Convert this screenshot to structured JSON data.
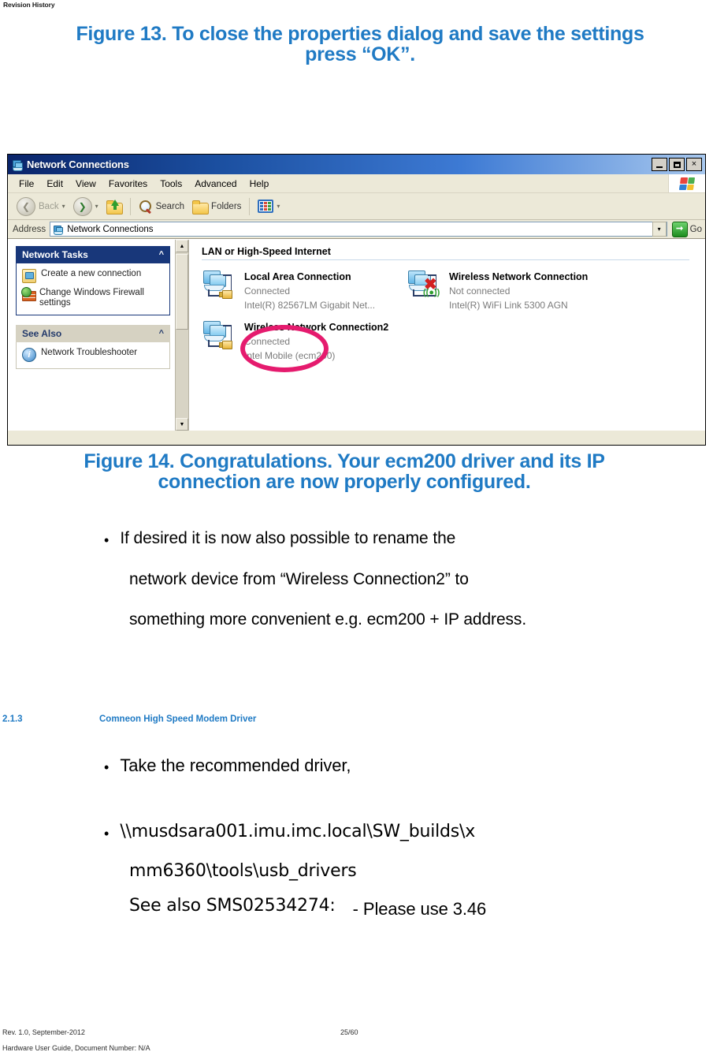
{
  "document": {
    "running_header": "Revision History",
    "figure13_caption_line1": "Figure 13. To close the properties dialog and save the settings",
    "figure13_caption_line2": "press “OK”.",
    "figure14_caption_line1": "Figure 14.  Congratulations. Your ecm200 driver and its IP",
    "figure14_caption_line2": "connection are now properly configured."
  },
  "explorer": {
    "title": "Network Connections",
    "title_icon": "network-connections-icon",
    "window_buttons": {
      "minimize": "minimize-icon",
      "maximize": "maximize-icon",
      "close": "×"
    },
    "menu": [
      "File",
      "Edit",
      "View",
      "Favorites",
      "Tools",
      "Advanced",
      "Help"
    ],
    "menu_logo": "windows-flag-icon",
    "toolbar": {
      "back_label": "Back",
      "back_icon": "back-arrow-icon",
      "forward_icon": "forward-arrow-icon",
      "up_icon": "folder-up-icon",
      "search_label": "Search",
      "search_icon": "search-icon",
      "folders_label": "Folders",
      "folders_icon": "folder-icon",
      "views_icon": "views-icon",
      "dropdown_caret": "▾"
    },
    "address": {
      "label": "Address",
      "value": "Network Connections",
      "icon": "network-connections-icon",
      "dropdown_caret": "▾",
      "go_label": "Go",
      "go_icon": "go-arrow-icon"
    },
    "sidebar": {
      "panels": [
        {
          "title": "Network Tasks",
          "collapse_icon": "chevron-up-icon",
          "style": "blue",
          "items": [
            {
              "label": "Create a new connection",
              "icon": "new-connection-icon"
            },
            {
              "label": "Change Windows Firewall settings",
              "icon": "firewall-icon"
            }
          ]
        },
        {
          "title": "See Also",
          "collapse_icon": "chevron-up-icon",
          "style": "gray",
          "items": [
            {
              "label": "Network Troubleshooter",
              "icon": "info-icon"
            }
          ]
        }
      ]
    },
    "scrollbar": {
      "up_arrow": "▲",
      "down_arrow": "▼"
    },
    "content": {
      "group_title": "LAN or High-Speed Internet",
      "connections": [
        {
          "name": "Local Area Connection",
          "status": "Connected",
          "device": "Intel(R) 82567LM Gigabit Net...",
          "icon": "network-adapter-icon",
          "state": "connected"
        },
        {
          "name": "Wireless Network Connection",
          "status": "Not connected",
          "device": "Intel(R) WiFi Link 5300 AGN",
          "icon": "wireless-adapter-icon",
          "state": "disconnected"
        },
        {
          "name": "Wireless Network Connection2",
          "status": "Connected",
          "device": "Intel Mobile (ecm200)",
          "icon": "network-adapter-icon",
          "state": "connected"
        }
      ],
      "annotation": "red-oval-highlight"
    }
  },
  "body": {
    "bullets_after_fig14": [
      "If desired it is now also possible to rename the",
      "network device from “Wireless Connection2” to",
      "something more convenient e.g. ecm200 + IP address."
    ],
    "section": {
      "number": "2.1.3",
      "title": "Comneon High Speed Modem Driver"
    },
    "bullets_driver": {
      "item1": "Take the recommended driver,",
      "item2_line1": "\\\\musdsara001.imu.imc.local\\SW_builds\\x",
      "item2_line2": "mm6360\\tools\\usb_drivers",
      "item2_line3_main": "See also SMS02534274:",
      "item2_line3_note": "- Please use 3.46"
    }
  },
  "footer": {
    "left": "Rev. 1.0, September-2012",
    "page": "25/60",
    "bottom": "Hardware User Guide, Document Number: N/A"
  },
  "colors": {
    "accent_blue": "#1f7ac4",
    "titlebar_blue": "#0a246a",
    "panel_blue": "#18377a",
    "annotation_pink": "#e51b6e"
  }
}
